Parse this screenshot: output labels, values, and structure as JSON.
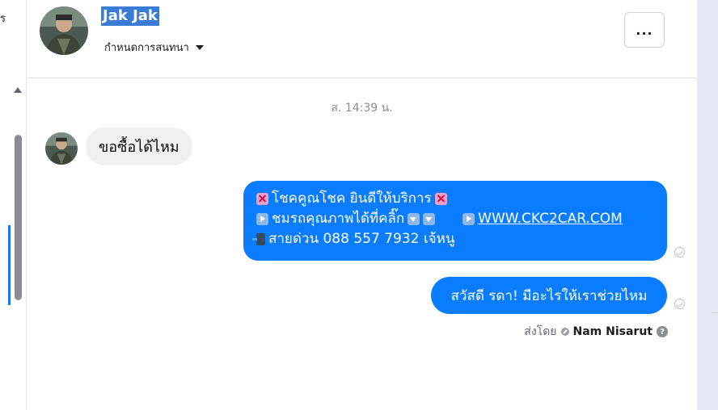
{
  "left_edge": {
    "char": "ร"
  },
  "header": {
    "title": "Jak Jak",
    "subtitle": "กำหนดการสนทนา",
    "more_label": "..."
  },
  "thread": {
    "timestamp": "ส. 14:39 น.",
    "incoming": {
      "text": "ขอซื้อได้ไหม"
    },
    "outgoing_1": {
      "line1": "โชคคูณโชค ยินดีให้บริการ",
      "line2": "ชมรถคุณภาพได้ที่คลิ๊ก",
      "link": "WWW.CKC2CAR.COM",
      "line3": " สายด่วน 088 557 7932 เจ้หนู"
    },
    "outgoing_2": {
      "text": "สวัสดี รดา! มีอะไรให้เราช่วยไหม"
    },
    "sent_by": {
      "prefix": "ส่งโดย",
      "name": "Nam Nisarut"
    }
  },
  "colors": {
    "accent": "#0a7cff",
    "title_highlight": "#3a7bd5",
    "incoming_bubble": "#f0f0f0"
  },
  "icons": [
    "more-icon",
    "caret-down-icon",
    "seen-icon",
    "help-icon",
    "scroll-up-icon"
  ]
}
